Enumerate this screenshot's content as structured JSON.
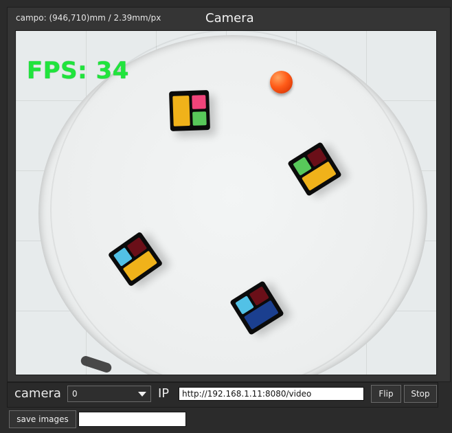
{
  "window": {
    "info": "campo: (946,710)mm / 2.39mm/px",
    "title": "Camera"
  },
  "view": {
    "fps_text": "FPS: 34"
  },
  "colors": {
    "yellow": "#f0b21a",
    "pink": "#f0447a",
    "green": "#58c85a",
    "dark_red": "#6a0f18",
    "cyan": "#52c1e6",
    "blue": "#1b3f8f"
  },
  "controls": {
    "camera_label": "camera",
    "camera_selected": "0",
    "ip_label": "IP",
    "ip_value": "http://192.168.1.11:8080/video",
    "flip_label": "Flip",
    "stop_label": "Stop",
    "save_label": "save images",
    "save_input_value": ""
  }
}
